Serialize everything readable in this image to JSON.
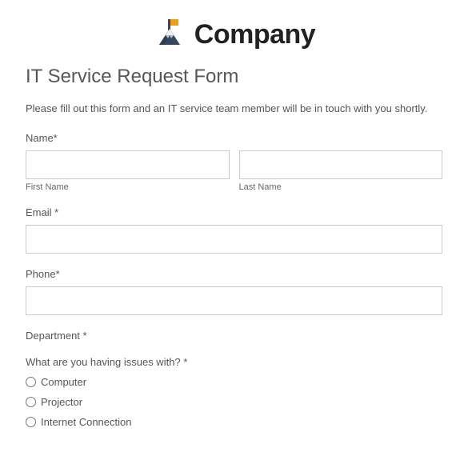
{
  "header": {
    "company_name": "Company"
  },
  "form": {
    "title": "IT Service Request Form",
    "description": "Please fill out this form and an IT service team member will be in touch with you shortly.",
    "name": {
      "label": "Name*",
      "first_sublabel": "First Name",
      "last_sublabel": "Last Name"
    },
    "email": {
      "label": "Email *"
    },
    "phone": {
      "label": "Phone*"
    },
    "department": {
      "label": "Department *"
    },
    "issues": {
      "label": "What are you having issues with? *",
      "options": [
        "Computer",
        "Projector",
        "Internet Connection"
      ]
    }
  }
}
